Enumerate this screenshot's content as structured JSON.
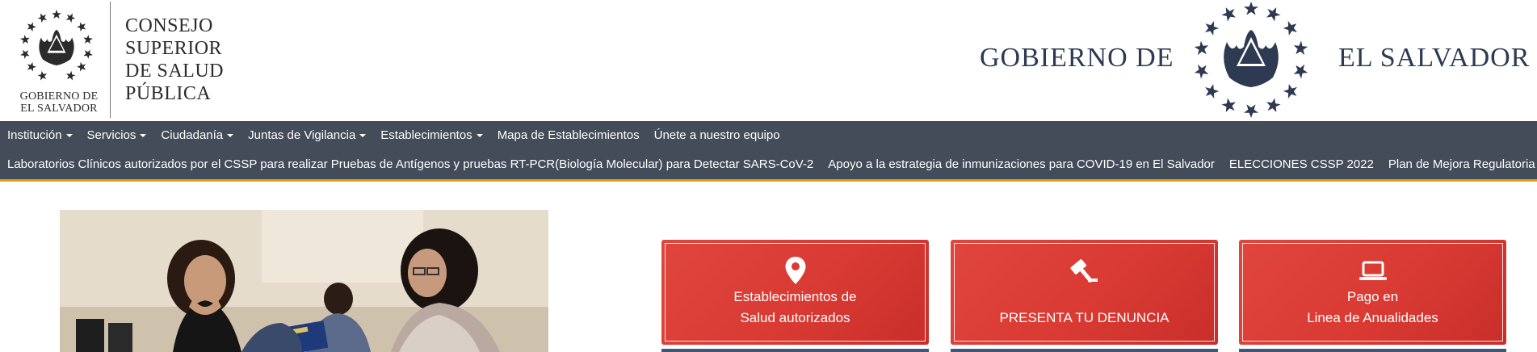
{
  "header": {
    "left_logo_text_line1": "GOBIERNO DE",
    "left_logo_text_line2": "EL SALVADOR",
    "org_name_lines": [
      "CONSEJO",
      "SUPERIOR",
      "DE SALUD",
      "PÚBLICA"
    ],
    "right_text_left": "GOBIERNO DE",
    "right_text_right": "EL SALVADOR",
    "seal_icon": "el-salvador-coat-of-arms-icon"
  },
  "nav": {
    "row1": [
      {
        "label": "Institución",
        "dropdown": true
      },
      {
        "label": "Servicios",
        "dropdown": true
      },
      {
        "label": "Ciudadanía",
        "dropdown": true
      },
      {
        "label": "Juntas de Vigilancia",
        "dropdown": true
      },
      {
        "label": "Establecimientos",
        "dropdown": true
      },
      {
        "label": "Mapa de Establecimientos",
        "dropdown": false
      },
      {
        "label": "Únete a nuestro equipo",
        "dropdown": false
      }
    ],
    "row2": [
      {
        "label": "Laboratorios Clínicos autorizados por el CSSP para realizar Pruebas de Antígenos y pruebas RT-PCR(Biología Molecular) para Detectar SARS-CoV-2"
      },
      {
        "label": "Apoyo a la estrategia de inmunizaciones para COVID-19 en El Salvador"
      },
      {
        "label": "ELECCIONES CSSP 2022"
      },
      {
        "label": "Plan de Mejora Regulatoria CSSP"
      }
    ],
    "colors": {
      "background": "#444c59",
      "accent_border": "#d9a81a"
    }
  },
  "cards": [
    {
      "icon": "map-marker-icon",
      "line1": "Establecimientos de",
      "line2": "Salud autorizados"
    },
    {
      "icon": "gavel-icon",
      "line1": "",
      "line2": "PRESENTA TU DENUNCIA"
    },
    {
      "icon": "laptop-icon",
      "line1": "Pago en",
      "line2": "Linea de Anualidades"
    }
  ],
  "card_color": "#d93a33",
  "photo": {
    "description_icon": "news-photo"
  }
}
